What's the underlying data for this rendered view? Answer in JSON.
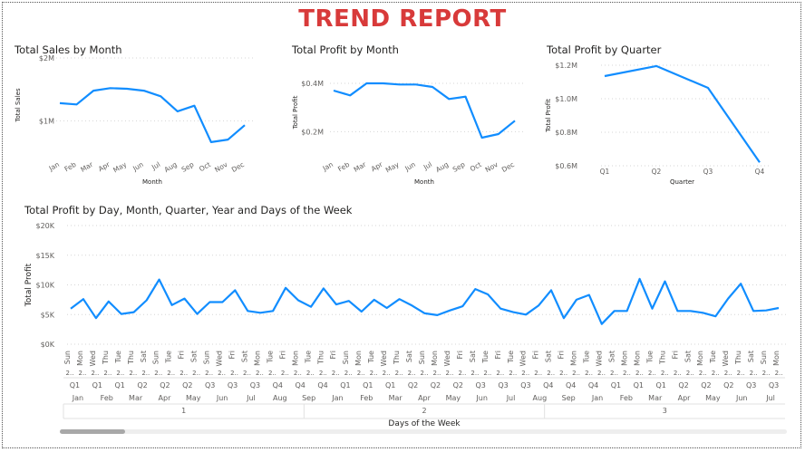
{
  "report_title": "TREND REPORT",
  "colors": {
    "line": "#118DFF",
    "title": "#D83A3A"
  },
  "chart_data": [
    {
      "type": "line",
      "title": "Total Sales by Month",
      "xlabel": "Month",
      "ylabel": "Total Sales",
      "categories": [
        "Jan",
        "Feb",
        "Mar",
        "Apr",
        "May",
        "Jun",
        "Jul",
        "Aug",
        "Sep",
        "Oct",
        "Nov",
        "Dec"
      ],
      "values": [
        1.28,
        1.26,
        1.48,
        1.52,
        1.51,
        1.48,
        1.39,
        1.15,
        1.24,
        0.66,
        0.7,
        0.93
      ],
      "ylim": [
        0.5,
        2.0
      ],
      "yticks": [
        {
          "v": 1.0,
          "label": "$1M"
        },
        {
          "v": 2.0,
          "label": "$2M"
        }
      ],
      "grid": true
    },
    {
      "type": "line",
      "title": "Total Profit by Month",
      "xlabel": "Month",
      "ylabel": "Total Profit",
      "categories": [
        "Jan",
        "Feb",
        "Mar",
        "Apr",
        "May",
        "Jun",
        "Jul",
        "Aug",
        "Sep",
        "Oct",
        "Nov",
        "Dec"
      ],
      "values": [
        0.37,
        0.35,
        0.4,
        0.4,
        0.395,
        0.395,
        0.385,
        0.335,
        0.345,
        0.175,
        0.19,
        0.245
      ],
      "ylim": [
        0.13,
        0.43
      ],
      "yticks": [
        {
          "v": 0.2,
          "label": "$0.2M"
        },
        {
          "v": 0.4,
          "label": "$0.4M"
        }
      ],
      "grid": true
    },
    {
      "type": "line",
      "title": "Total Profit by Quarter",
      "xlabel": "Quarter",
      "ylabel": "Total Profit",
      "categories": [
        "Q1",
        "Q2",
        "Q3",
        "Q4"
      ],
      "values": [
        1.135,
        1.195,
        1.065,
        0.62
      ],
      "ylim": [
        0.6,
        1.2
      ],
      "yticks": [
        {
          "v": 0.6,
          "label": "$0.6M"
        },
        {
          "v": 0.8,
          "label": "$0.8M"
        },
        {
          "v": 1.0,
          "label": "$1.0M"
        },
        {
          "v": 1.2,
          "label": "$1.2M"
        }
      ],
      "grid": true
    },
    {
      "type": "line",
      "title": "Total Profit by Day, Month, Quarter, Year and Days of the Week",
      "xlabel": "Days of the Week",
      "ylabel": "Total Profit",
      "categories": [
        "Sun",
        "Mon",
        "Wed",
        "Thu",
        "Tue",
        "Thu",
        "Sat",
        "Sun",
        "Tue",
        "Fri",
        "Sat",
        "Sun",
        "Wed",
        "Fri",
        "Sat",
        "Mon",
        "Tue",
        "Fri",
        "Mon",
        "Tue",
        "Thu",
        "Fri",
        "Sun",
        "Mon",
        "Tue",
        "Wed",
        "Thu",
        "Sat",
        "Sun",
        "Mon",
        "Wed",
        "Fri",
        "Sat",
        "Tue",
        "Fri",
        "Tue",
        "Wed",
        "Fri",
        "Sat",
        "Fri",
        "Mon",
        "Tue",
        "Wed",
        "Sat",
        "Mon",
        "Mon",
        "Tue",
        "Thu"
      ],
      "values": [
        6.0,
        7.6,
        4.4,
        7.2,
        5.1,
        5.4,
        7.4,
        10.9,
        6.6,
        7.7,
        5.1,
        7.1,
        7.1,
        9.1,
        5.6,
        5.3,
        5.6,
        9.5,
        7.4,
        6.3,
        9.4,
        6.7,
        7.3,
        5.5,
        7.5,
        6.1,
        7.6,
        6.5,
        5.2,
        4.9,
        5.7,
        6.4,
        9.3,
        8.4,
        6.0,
        5.4,
        5.0,
        6.5,
        9.1,
        4.4,
        7.5,
        8.3,
        3.4,
        5.6,
        5.6,
        11.0,
        6.0,
        10.6,
        5.6,
        5.6,
        5.3,
        4.7,
        7.7,
        10.2,
        5.6,
        5.7,
        6.1
      ],
      "x_level_labels": {
        "level1": [
          "Sun",
          "Mon",
          "Wed",
          "Thu",
          "Tue",
          "Thu",
          "Sat",
          "Sun",
          "Tue",
          "Fri",
          "Sat",
          "Sun",
          "Wed",
          "Fri",
          "Sat",
          "Mon",
          "Tue",
          "Fri",
          "Mon",
          "Tue",
          "Thu",
          "Fri",
          "Sun",
          "Mon",
          "Tue",
          "Wed",
          "Thu",
          "Sat",
          "Sun",
          "Mon",
          "Wed",
          "Fri",
          "Sat",
          "Tue",
          "Fri",
          "Tue",
          "Wed",
          "Fri",
          "Sat",
          "Fri",
          "Mon",
          "Tue",
          "Wed",
          "Sat",
          "Mon",
          "Mon",
          "Tue",
          "Thu",
          "Fri",
          "Sat",
          "Mon",
          "Tue",
          "Wed",
          "Thu",
          "Sat",
          "Sun",
          "Mon"
        ],
        "quarters": [
          "Q1",
          "Q1",
          "Q1",
          "Q2",
          "Q2",
          "Q2",
          "Q3",
          "Q3",
          "Q3",
          "Q4",
          "Q4",
          "Q4",
          "Q1",
          "Q1",
          "Q1",
          "Q2",
          "Q2",
          "Q2",
          "Q3",
          "Q3",
          "Q3",
          "Q4",
          "Q4",
          "Q4",
          "Q1",
          "Q1",
          "Q1",
          "Q2",
          "Q2",
          "Q2",
          "Q3",
          "Q3"
        ],
        "months": [
          "Jan",
          "Feb",
          "Mar",
          "Apr",
          "May",
          "Jun",
          "Jul",
          "Aug",
          "Sep",
          "Jan",
          "Feb",
          "Mar",
          "Apr",
          "May",
          "Jun",
          "Jul",
          "Aug",
          "Sep",
          "Jan",
          "Feb",
          "Mar",
          "Apr",
          "May",
          "Jun",
          "Jul"
        ],
        "groups": [
          "1",
          "2",
          "3"
        ]
      },
      "ylim": [
        0,
        20
      ],
      "yticks": [
        {
          "v": 0,
          "label": "$0K"
        },
        {
          "v": 5,
          "label": "$5K"
        },
        {
          "v": 10,
          "label": "$10K"
        },
        {
          "v": 15,
          "label": "$15K"
        },
        {
          "v": 20,
          "label": "$20K"
        }
      ],
      "grid": true
    }
  ]
}
